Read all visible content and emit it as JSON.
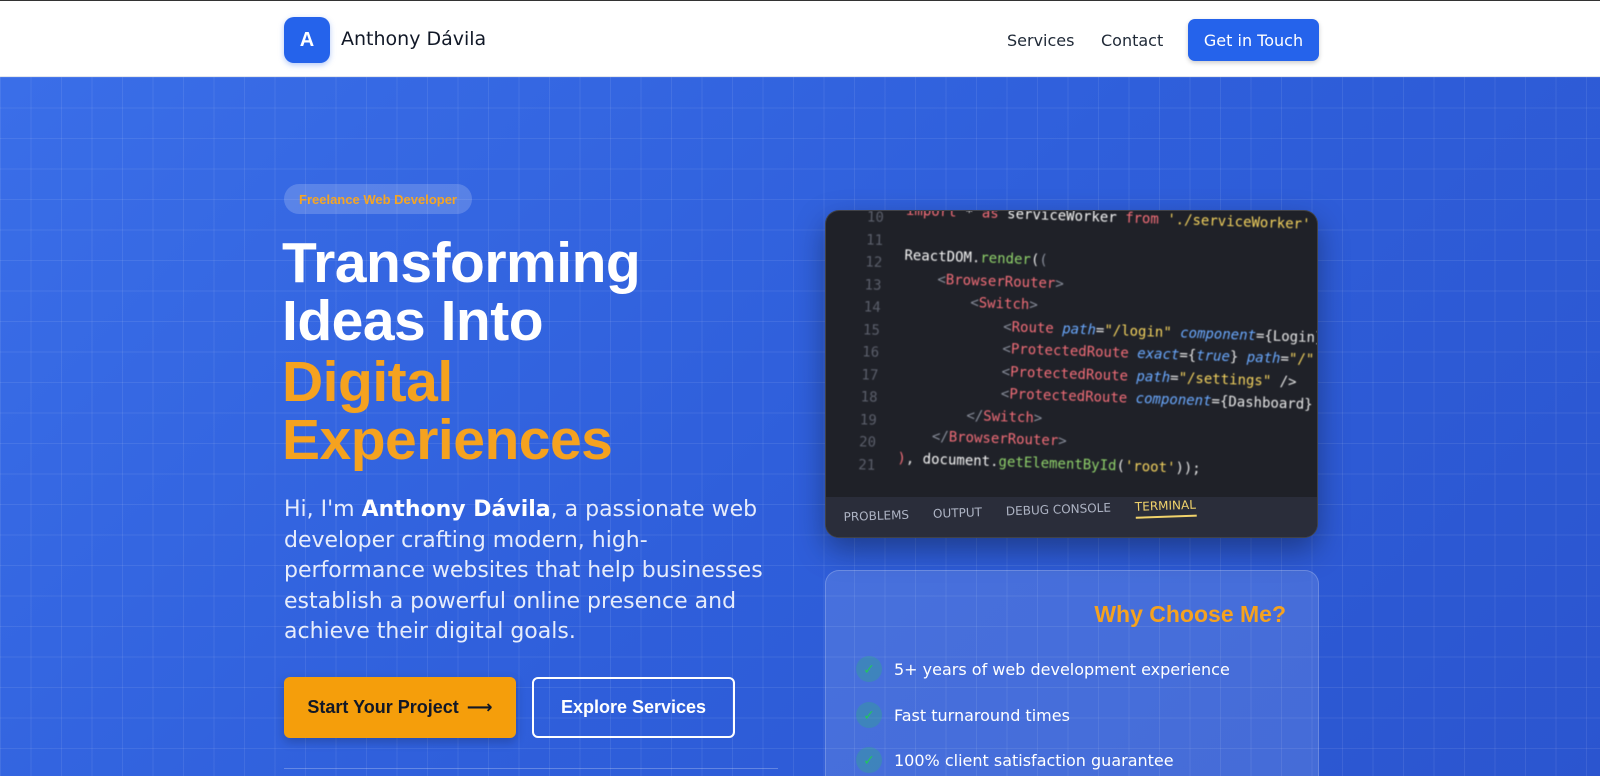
{
  "nav": {
    "logo_letter": "A",
    "brand": "Anthony Dávila",
    "links": [
      {
        "label": "Services"
      },
      {
        "label": "Contact"
      }
    ],
    "cta": "Get in Touch"
  },
  "hero": {
    "badge": "Freelance Web Developer",
    "headline_line1": "Transforming",
    "headline_line2": "Ideas Into",
    "headline_accent1": "Digital",
    "headline_accent2": "Experiences",
    "intro_prefix": "Hi, I'm ",
    "intro_name": "Anthony Dávila",
    "intro_rest": ", a passionate web developer crafting modern, high-performance websites that help businesses establish a powerful online presence and achieve their digital goals.",
    "primary_button": "Start Your Project",
    "secondary_button": "Explore Services"
  },
  "code_panel": {
    "line_numbers": [
      "10",
      "11",
      "12",
      "13",
      "14",
      "15",
      "16",
      "17",
      "18",
      "19",
      "20",
      "21"
    ],
    "tabs": [
      "PROBLEMS",
      "OUTPUT",
      "DEBUG CONSOLE",
      "TERMINAL"
    ],
    "active_tab": "TERMINAL"
  },
  "why": {
    "title": "Why Choose Me?",
    "items": [
      {
        "label": "5+ years of web development experience"
      },
      {
        "label": "Fast turnaround times"
      },
      {
        "label": "100% client satisfaction guarantee"
      }
    ]
  },
  "colors": {
    "primary": "#2563eb",
    "accent": "#f59e0b",
    "hero_bg": "#2f5fdc"
  },
  "icons": {
    "arrow": "arrow-right-icon",
    "check": "check-icon"
  }
}
